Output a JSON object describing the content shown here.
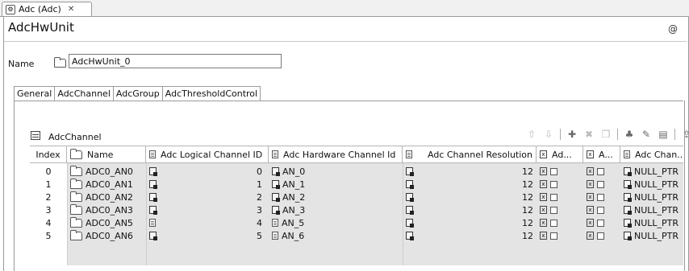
{
  "editor_tab": {
    "label": "Adc (Adc)"
  },
  "page_title": "AdcHwUnit",
  "name_field": {
    "label": "Name",
    "value": "AdcHwUnit_0"
  },
  "sub_tabs": [
    "General",
    "AdcChannel",
    "AdcGroup",
    "AdcThresholdControl"
  ],
  "section_title": "AdcChannel",
  "toolbar": {
    "icons": [
      "move-up-icon",
      "move-down-icon",
      "add-icon",
      "delete-icon",
      "copy-icon",
      "settings-icon",
      "edit-icon",
      "table-icon",
      "export-icon"
    ]
  },
  "table": {
    "headers": [
      "Index",
      "Name",
      "Adc Logical Channel ID",
      "Adc Hardware Channel Id",
      "Adc Channel Resolution",
      "Ad...",
      "A...",
      "Adc Chan..."
    ],
    "rows": [
      {
        "index": "0",
        "name": "ADC0_AN0",
        "logical_id": "0",
        "hw_id": "AN_0",
        "resolution": "12",
        "chan": "NULL_PTR"
      },
      {
        "index": "1",
        "name": "ADC0_AN1",
        "logical_id": "1",
        "hw_id": "AN_1",
        "resolution": "12",
        "chan": "NULL_PTR"
      },
      {
        "index": "2",
        "name": "ADC0_AN2",
        "logical_id": "2",
        "hw_id": "AN_2",
        "resolution": "12",
        "chan": "NULL_PTR"
      },
      {
        "index": "3",
        "name": "ADC0_AN3",
        "logical_id": "3",
        "hw_id": "AN_3",
        "resolution": "12",
        "chan": "NULL_PTR"
      },
      {
        "index": "4",
        "name": "ADC0_AN5",
        "logical_id": "4",
        "hw_id": "AN_5",
        "resolution": "12",
        "chan": "NULL_PTR"
      },
      {
        "index": "5",
        "name": "ADC0_AN6",
        "logical_id": "5",
        "hw_id": "AN_6",
        "resolution": "12",
        "chan": "NULL_PTR"
      }
    ]
  }
}
